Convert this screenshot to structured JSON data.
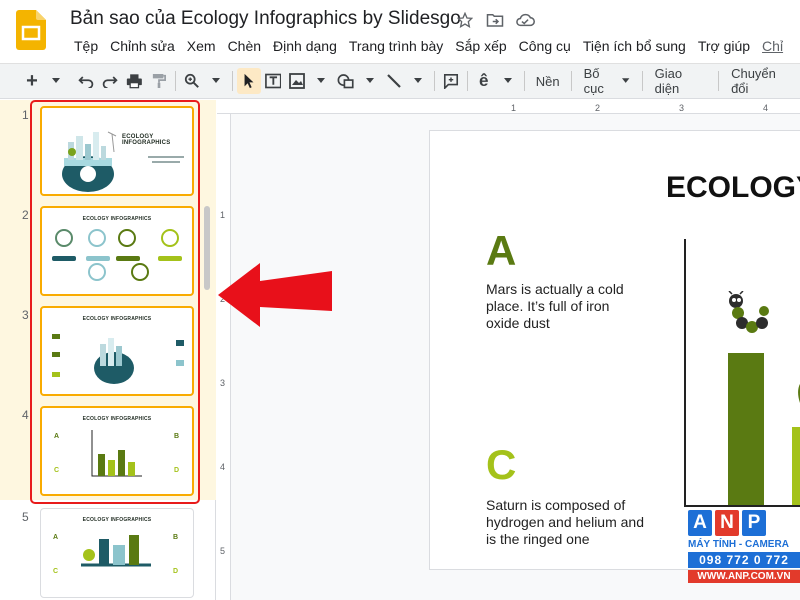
{
  "app": {
    "doc_title": "Bản sao của Ecology Infographics by Slidesgo",
    "menu": [
      "Tệp",
      "Chỉnh sửa",
      "Xem",
      "Chèn",
      "Định dạng",
      "Trang trình bày",
      "Sắp xếp",
      "Công cụ",
      "Tiện ích bổ sung",
      "Trợ giúp"
    ],
    "menu_extra": "Chỉ",
    "icons": {
      "logo": "google-slides-logo",
      "star": "star-icon",
      "move": "move-to-folder-icon",
      "cloud": "cloud-saved-icon"
    }
  },
  "toolbar": {
    "buttons": {
      "new": "+",
      "background": "Nền",
      "layout": "Bố cục",
      "theme": "Giao diện",
      "transition": "Chuyển đổi"
    }
  },
  "filmstrip": {
    "slides": [
      {
        "number": "1",
        "title": "ECOLOGY INFOGRAPHICS"
      },
      {
        "number": "2",
        "title": "ECOLOGY INFOGRAPHICS"
      },
      {
        "number": "3",
        "title": "ECOLOGY INFOGRAPHICS"
      },
      {
        "number": "4",
        "title": "ECOLOGY INFOGRAPHICS"
      },
      {
        "number": "5",
        "title": "ECOLOGY INFOGRAPHICS"
      }
    ],
    "selected_count": 4
  },
  "rulers": {
    "top": [
      "1",
      "2",
      "3",
      "4"
    ],
    "left": [
      "1",
      "2",
      "3",
      "4",
      "5"
    ]
  },
  "slide": {
    "title": "ECOLOGY",
    "items": [
      {
        "letter": "A",
        "text": "Mars is actually a cold place. It’s full of iron oxide dust"
      },
      {
        "letter": "C",
        "text": "Saturn is composed of hydrogen and helium and is the ringed one"
      }
    ],
    "colors": {
      "dark_green": "#5a7a12",
      "light_green": "#a4c21a"
    }
  },
  "watermark": {
    "letters": [
      "A",
      "N",
      "P"
    ],
    "tagline": "MÁY TÍNH - CAMERA",
    "phone": "098 772 0 772",
    "url": "WWW.ANP.COM.VN"
  }
}
